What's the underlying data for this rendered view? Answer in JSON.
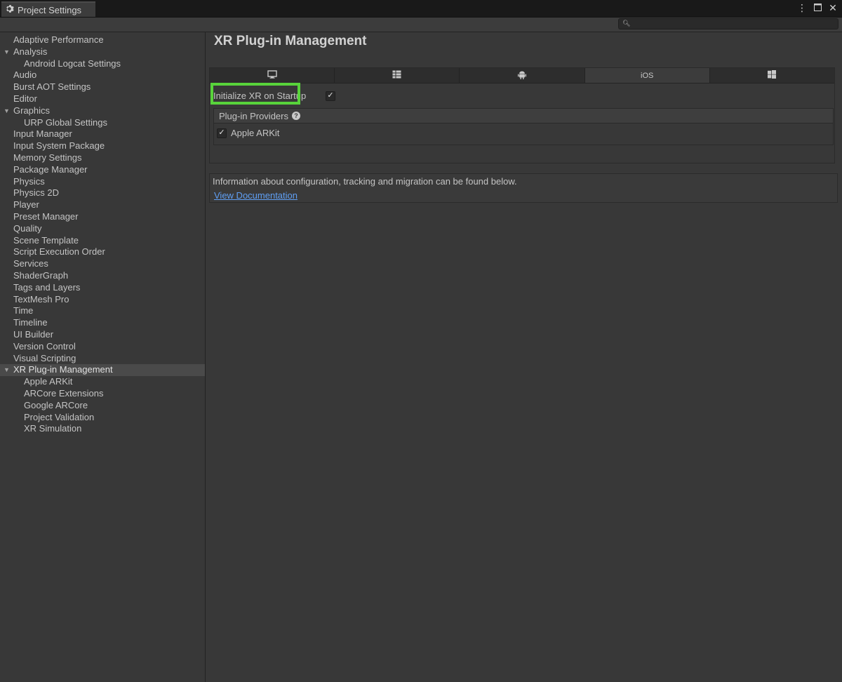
{
  "window": {
    "tab_title": "Project Settings",
    "tab_icon": "gear-icon",
    "controls": [
      "more-icon",
      "maximize-icon",
      "close-icon"
    ]
  },
  "search": {
    "value": "",
    "placeholder": ""
  },
  "sidebar": {
    "items": [
      {
        "label": "Adaptive Performance",
        "level": 0
      },
      {
        "label": "Analysis",
        "level": 0,
        "expanded": true
      },
      {
        "label": "Android Logcat Settings",
        "level": 1
      },
      {
        "label": "Audio",
        "level": 0
      },
      {
        "label": "Burst AOT Settings",
        "level": 0
      },
      {
        "label": "Editor",
        "level": 0
      },
      {
        "label": "Graphics",
        "level": 0,
        "expanded": true
      },
      {
        "label": "URP Global Settings",
        "level": 1
      },
      {
        "label": "Input Manager",
        "level": 0
      },
      {
        "label": "Input System Package",
        "level": 0
      },
      {
        "label": "Memory Settings",
        "level": 0
      },
      {
        "label": "Package Manager",
        "level": 0
      },
      {
        "label": "Physics",
        "level": 0
      },
      {
        "label": "Physics 2D",
        "level": 0
      },
      {
        "label": "Player",
        "level": 0
      },
      {
        "label": "Preset Manager",
        "level": 0
      },
      {
        "label": "Quality",
        "level": 0
      },
      {
        "label": "Scene Template",
        "level": 0
      },
      {
        "label": "Script Execution Order",
        "level": 0
      },
      {
        "label": "Services",
        "level": 0
      },
      {
        "label": "ShaderGraph",
        "level": 0
      },
      {
        "label": "Tags and Layers",
        "level": 0
      },
      {
        "label": "TextMesh Pro",
        "level": 0
      },
      {
        "label": "Time",
        "level": 0
      },
      {
        "label": "Timeline",
        "level": 0
      },
      {
        "label": "UI Builder",
        "level": 0
      },
      {
        "label": "Version Control",
        "level": 0
      },
      {
        "label": "Visual Scripting",
        "level": 0
      },
      {
        "label": "XR Plug-in Management",
        "level": 0,
        "expanded": true,
        "selected": true
      },
      {
        "label": "Apple ARKit",
        "level": 1
      },
      {
        "label": "ARCore Extensions",
        "level": 1
      },
      {
        "label": "Google ARCore",
        "level": 1
      },
      {
        "label": "Project Validation",
        "level": 1
      },
      {
        "label": "XR Simulation",
        "level": 1
      }
    ]
  },
  "main": {
    "title": "XR Plug-in Management",
    "platform_tabs": [
      {
        "icon": "desktop-monitor-icon",
        "label": ""
      },
      {
        "icon": "server-grid-icon",
        "label": ""
      },
      {
        "icon": "android-icon",
        "label": ""
      },
      {
        "icon": "",
        "label": "iOS",
        "active": true
      },
      {
        "icon": "windows-logo-icon",
        "label": ""
      }
    ],
    "initialize_label": "Initialize XR on Startup",
    "initialize_checked": true,
    "providers_header": "Plug-in Providers",
    "providers": [
      {
        "label": "Apple ARKit",
        "checked": true
      }
    ],
    "info_text": "Information about configuration, tracking and migration can be found below.",
    "doc_link": "View Documentation"
  },
  "colors": {
    "highlight": "#58d33b",
    "link": "#5f9ff4",
    "background": "#383838"
  }
}
